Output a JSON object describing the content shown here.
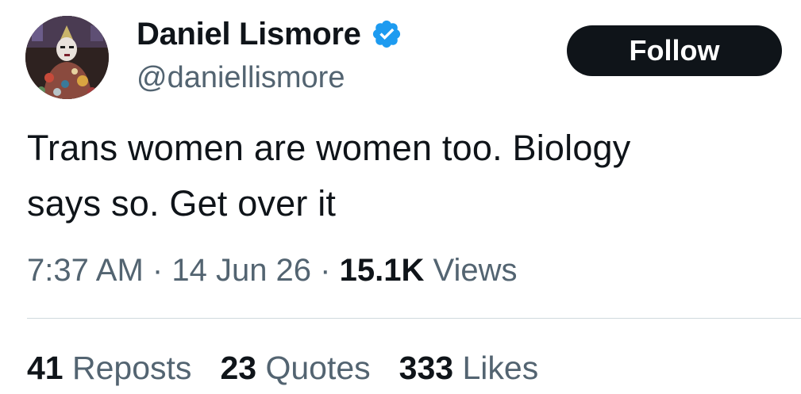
{
  "author": {
    "display_name": "Daniel Lismore",
    "handle": "@daniellismore",
    "verified_icon": "verified-badge-icon",
    "verified_color": "#1d9bf0"
  },
  "follow_button": {
    "label": "Follow"
  },
  "tweet": {
    "line1": "Trans women are women too. Biology",
    "line2": "says so. Get over it"
  },
  "meta": {
    "time": "7:37 AM",
    "separator": "·",
    "date": "14 Jun 26",
    "views_count": "15.1K",
    "views_label": "Views"
  },
  "stats": {
    "reposts_count": "41",
    "reposts_label": "Reposts",
    "quotes_count": "23",
    "quotes_label": "Quotes",
    "likes_count": "333",
    "likes_label": "Likes"
  },
  "colors": {
    "text_primary": "#0f1419",
    "text_secondary": "#536471",
    "button_bg": "#0f1419",
    "divider": "#cfd9de"
  }
}
